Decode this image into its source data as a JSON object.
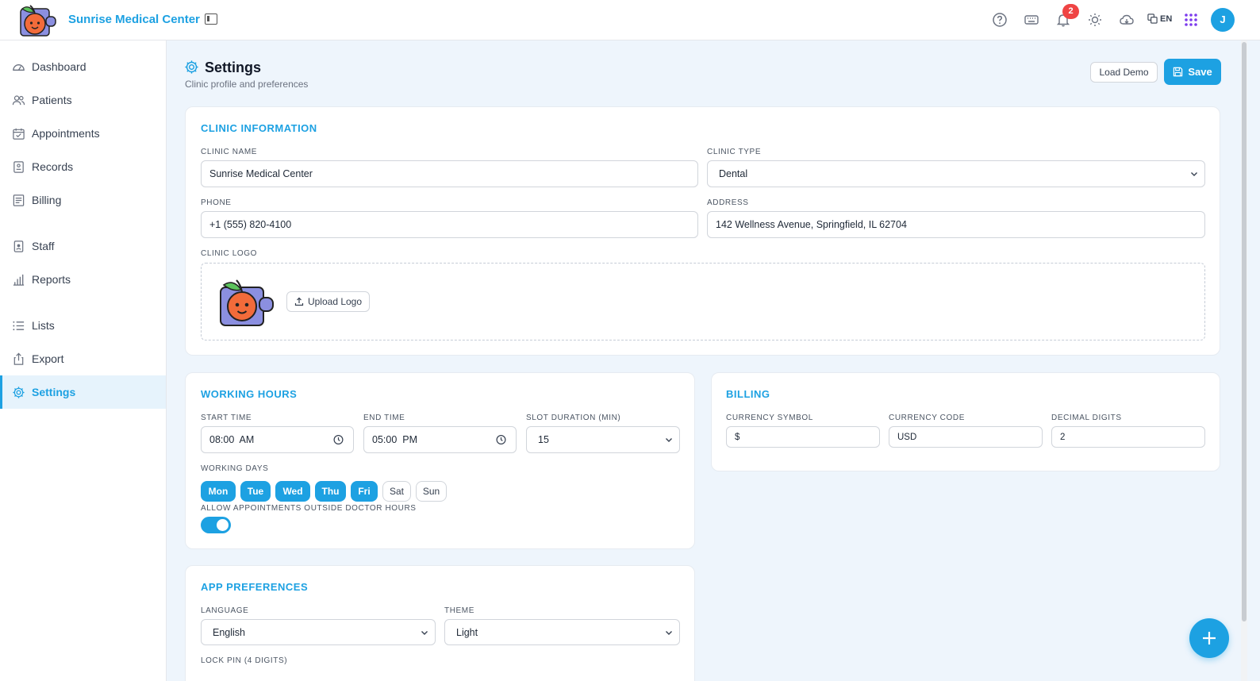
{
  "app": {
    "title": "Sunrise Medical Center"
  },
  "topbar": {
    "notifications_count": "2",
    "language": "EN",
    "avatar_initial": "J"
  },
  "sidebar": {
    "items": [
      {
        "label": "Dashboard",
        "icon": "gauge-icon"
      },
      {
        "label": "Patients",
        "icon": "users-icon"
      },
      {
        "label": "Appointments",
        "icon": "calendar-check-icon"
      },
      {
        "label": "Records",
        "icon": "file-record-icon"
      },
      {
        "label": "Billing",
        "icon": "receipt-icon"
      },
      {
        "label": "Staff",
        "icon": "badge-icon"
      },
      {
        "label": "Reports",
        "icon": "bar-chart-icon"
      },
      {
        "label": "Lists",
        "icon": "list-icon"
      },
      {
        "label": "Export",
        "icon": "share-icon"
      },
      {
        "label": "Settings",
        "icon": "gear-icon",
        "active": true
      }
    ]
  },
  "page": {
    "title": "Settings",
    "subtitle": "Clinic profile and preferences",
    "load_demo_label": "Load Demo",
    "save_label": "Save"
  },
  "clinic_info": {
    "title": "CLINIC INFORMATION",
    "name_label": "CLINIC NAME",
    "name_value": "Sunrise Medical Center",
    "type_label": "CLINIC TYPE",
    "type_value": "Dental",
    "phone_label": "PHONE",
    "phone_value": "+1 (555) 820-4100",
    "address_label": "ADDRESS",
    "address_value": "142 Wellness Avenue, Springfield, IL 62704",
    "logo_label": "CLINIC LOGO",
    "upload_label": "Upload Logo"
  },
  "working_hours": {
    "title": "WORKING HOURS",
    "start_label": "START TIME",
    "start_value": "08:00  AM",
    "end_label": "END TIME",
    "end_value": "05:00  PM",
    "slot_label": "SLOT DURATION (MIN)",
    "slot_value": "15",
    "days_label": "WORKING DAYS",
    "days": [
      {
        "label": "Mon",
        "on": true
      },
      {
        "label": "Tue",
        "on": true
      },
      {
        "label": "Wed",
        "on": true
      },
      {
        "label": "Thu",
        "on": true
      },
      {
        "label": "Fri",
        "on": true
      },
      {
        "label": "Sat",
        "on": false
      },
      {
        "label": "Sun",
        "on": false
      }
    ],
    "allow_outside_label": "ALLOW APPOINTMENTS OUTSIDE DOCTOR HOURS",
    "allow_outside_enabled": true
  },
  "billing": {
    "title": "BILLING",
    "currency_symbol_label": "CURRENCY SYMBOL",
    "currency_symbol_value": "$",
    "currency_code_label": "CURRENCY CODE",
    "currency_code_value": "USD",
    "decimal_digits_label": "DECIMAL DIGITS",
    "decimal_digits_value": "2"
  },
  "app_preferences": {
    "title": "APP PREFERENCES",
    "language_label": "LANGUAGE",
    "language_value": "English",
    "theme_label": "THEME",
    "theme_value": "Light",
    "lock_pin_label": "LOCK PIN (4 DIGITS)"
  },
  "colors": {
    "accent": "#1da1e2",
    "badge": "#ef4444",
    "background": "#eef5fc"
  }
}
